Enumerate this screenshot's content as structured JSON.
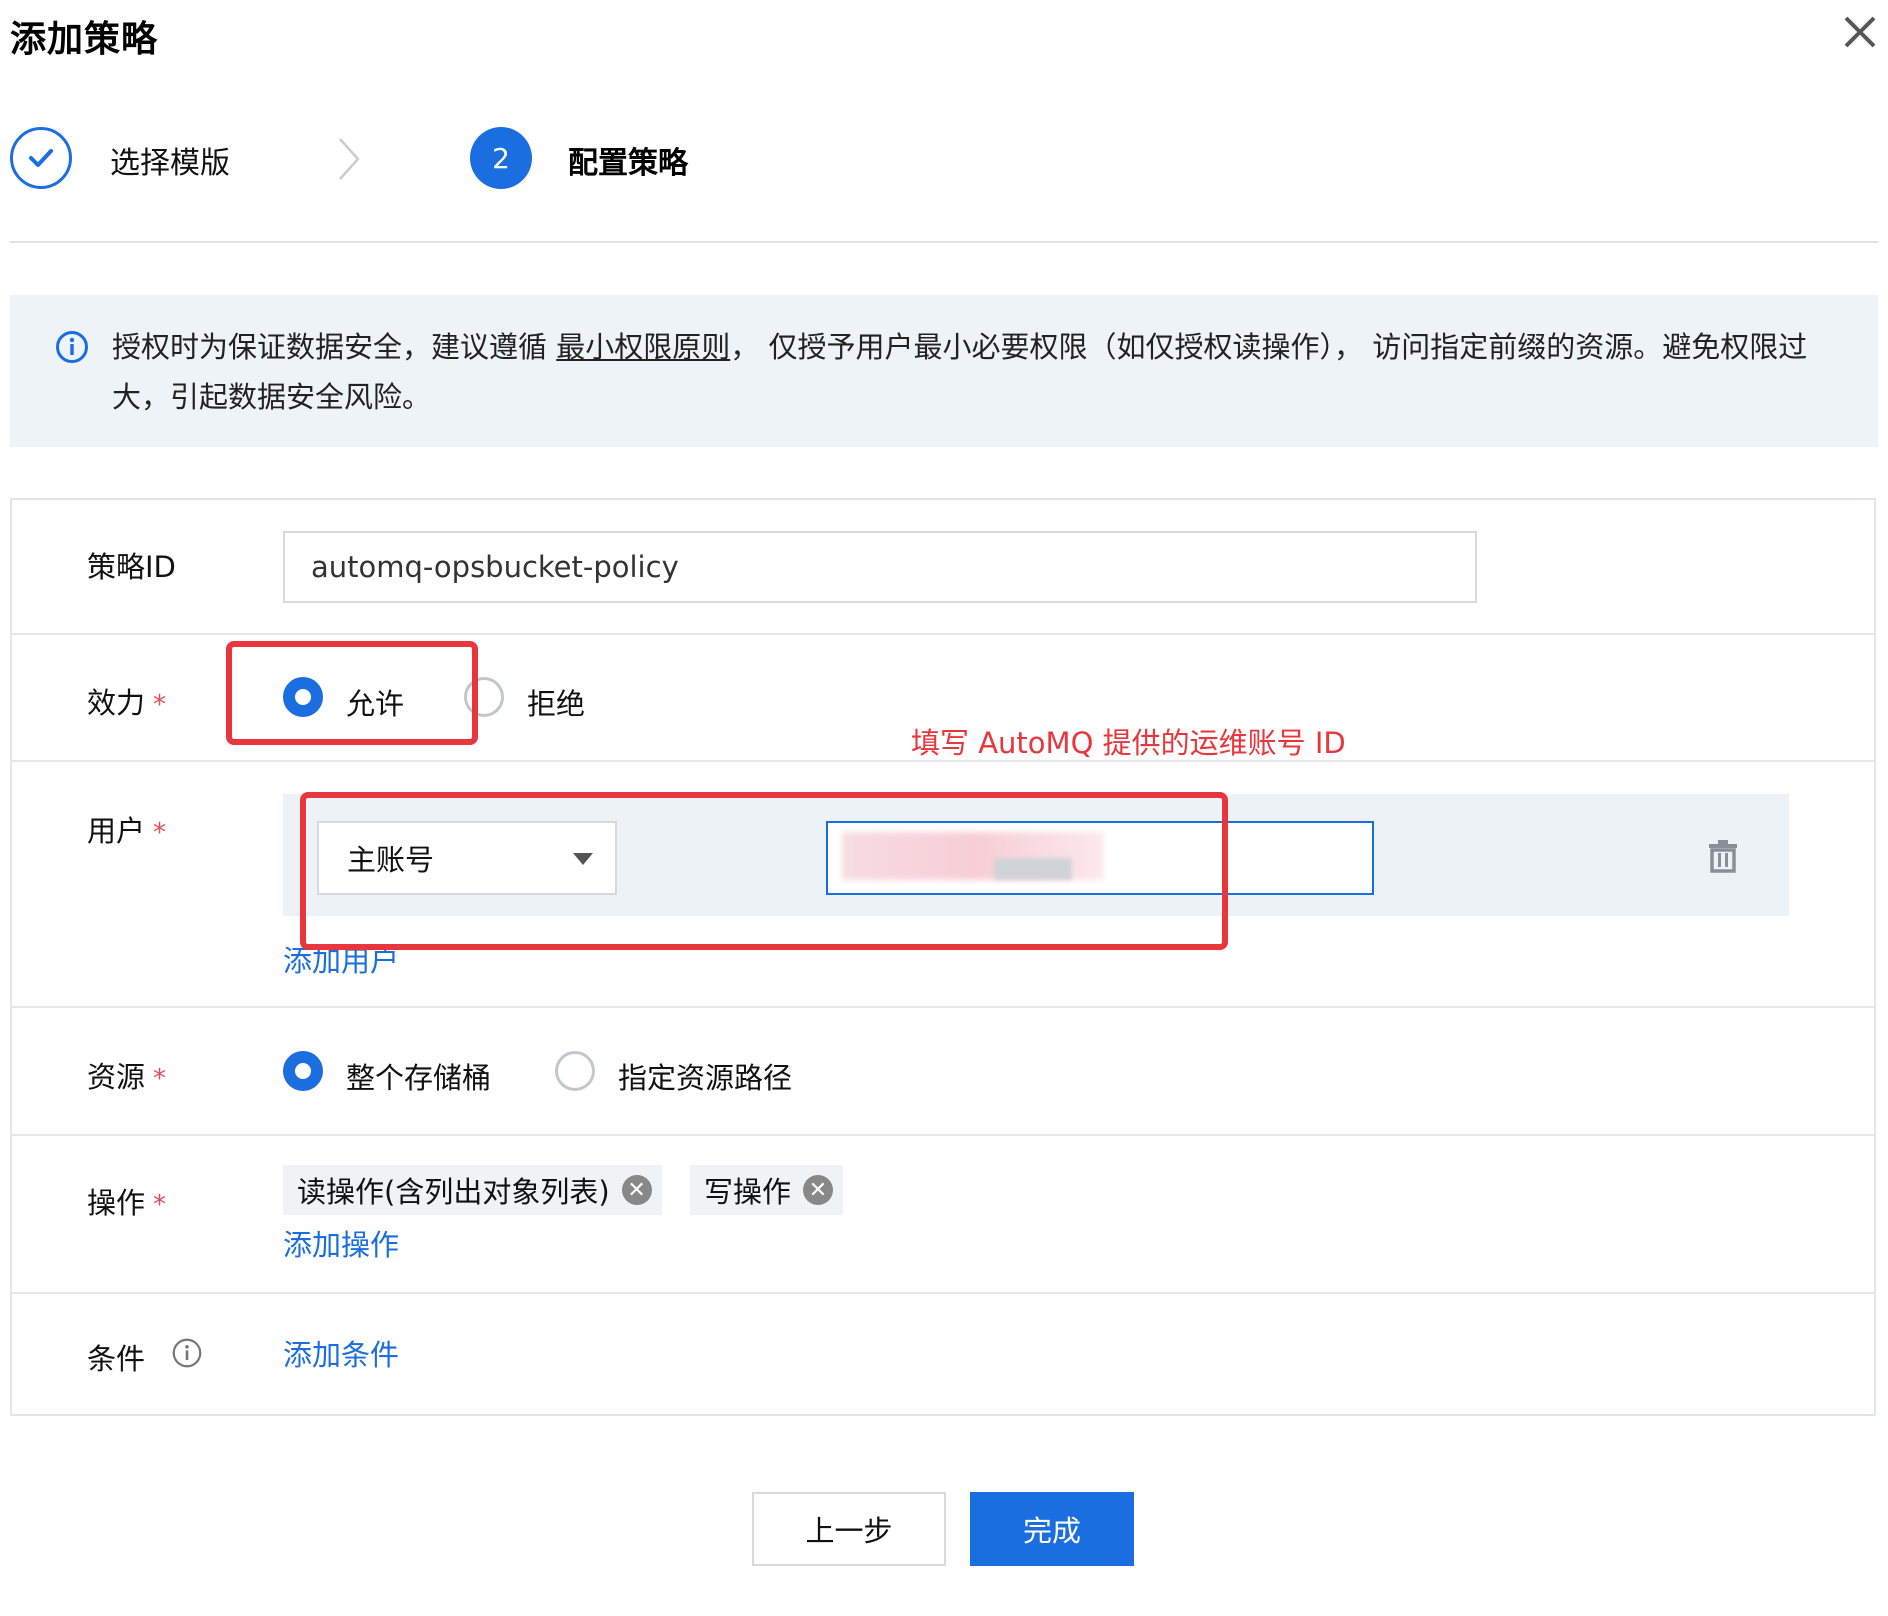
{
  "dialog": {
    "title": "添加策略",
    "close_icon": "close-icon"
  },
  "steps": [
    {
      "label": "选择模版",
      "state": "done",
      "icon": "check-icon"
    },
    {
      "label": "配置策略",
      "state": "active",
      "number": "2"
    }
  ],
  "alert": {
    "icon": "info-icon",
    "text_before": "授权时为保证数据安全，建议遵循 ",
    "link": "最小权限原则",
    "text_after": "， 仅授予用户最小必要权限（如仅授权读操作）， 访问指定前缀的资源。避免权限过大，引起数据安全风险。"
  },
  "form": {
    "policy_id": {
      "label": "策略ID",
      "value": "automq-opsbucket-policy"
    },
    "effect": {
      "label": "效力",
      "required": "*",
      "options": [
        {
          "label": "允许",
          "selected": true
        },
        {
          "label": "拒绝",
          "selected": false
        }
      ]
    },
    "user": {
      "label": "用户",
      "required": "*",
      "account_type": "主账号",
      "account_id": "",
      "add_label": "添加用户"
    },
    "resource": {
      "label": "资源",
      "required": "*",
      "options": [
        {
          "label": "整个存储桶",
          "selected": true
        },
        {
          "label": "指定资源路径",
          "selected": false
        }
      ]
    },
    "actions": {
      "label": "操作",
      "required": "*",
      "tags": [
        "读操作(含列出对象列表)",
        "写操作"
      ],
      "add_label": "添加操作"
    },
    "condition": {
      "label": "条件",
      "add_label": "添加条件"
    }
  },
  "annotation": {
    "text": "填写 AutoMQ 提供的运维账号 ID",
    "color": "#e8363c"
  },
  "footer": {
    "prev_label": "上一步",
    "done_label": "完成"
  },
  "colors": {
    "primary": "#1a6ee0",
    "alert_bg": "#edf3f7",
    "required": "#e34d59"
  }
}
